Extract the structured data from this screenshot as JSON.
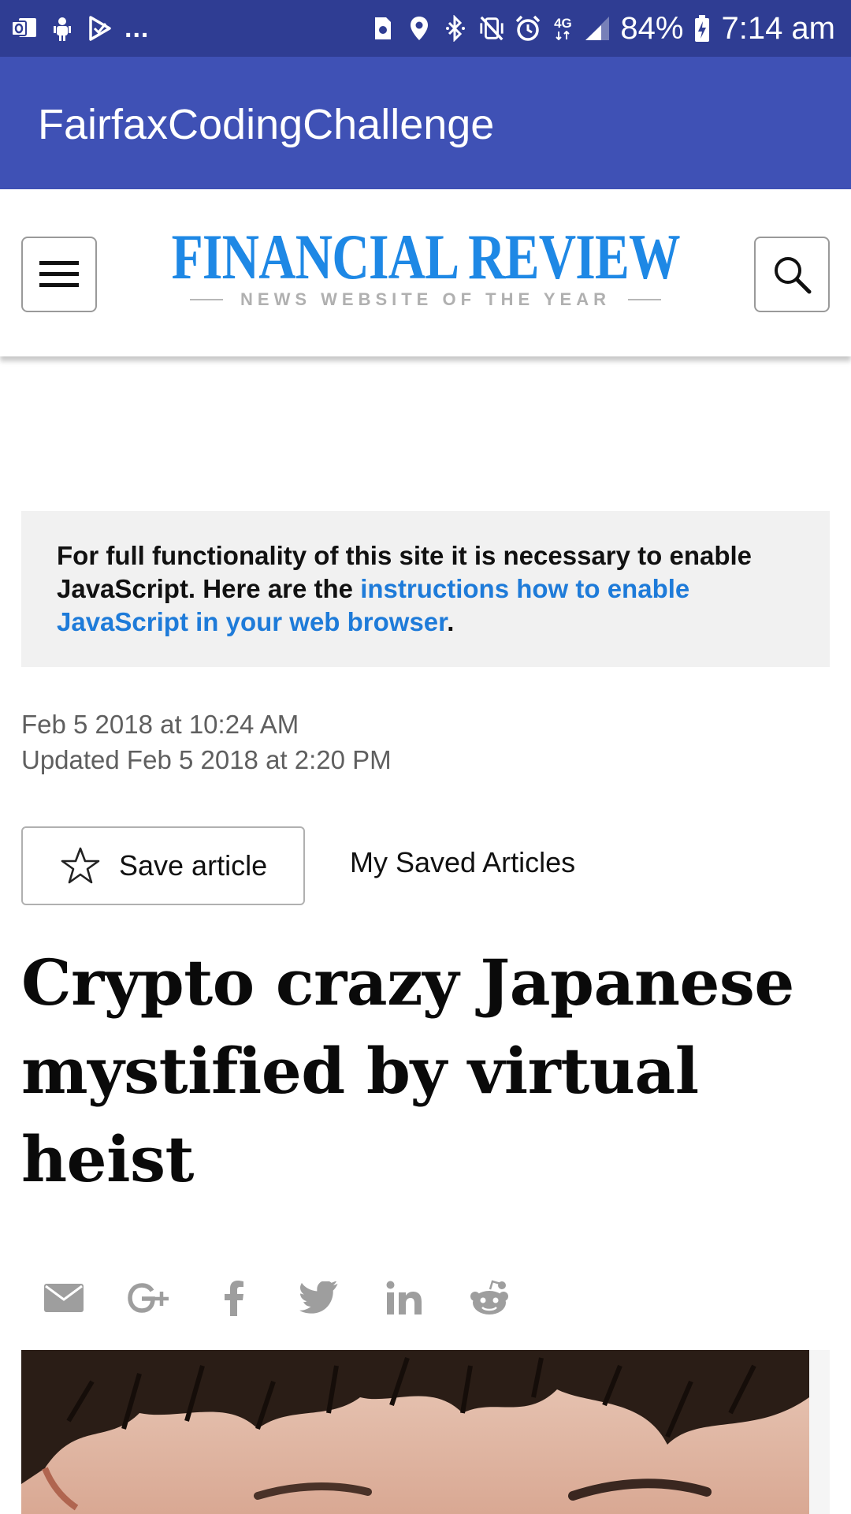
{
  "status_bar": {
    "left_icons": [
      "outlook-icon",
      "usb-debug-icon",
      "play-store-icon"
    ],
    "overflow": "...",
    "right_icons": [
      "sim-card-icon",
      "location-icon",
      "bluetooth-icon",
      "vibrate-mute-icon",
      "alarm-icon",
      "4g-icon",
      "signal-icon"
    ],
    "network": "4G",
    "battery": "84%",
    "time": "7:14 am"
  },
  "app_bar": {
    "title": "FairfaxCodingChallenge"
  },
  "site_header": {
    "logo_title": "FINANCIAL REVIEW",
    "logo_subtitle": "NEWS WEBSITE OF THE YEAR",
    "menu_icon": "hamburger-menu-icon",
    "search_icon": "search-icon"
  },
  "notice": {
    "text_before": "For full functionality of this site it is necessary to enable JavaScript. Here are the ",
    "link_text": "instructions how to enable JavaScript in your web browser",
    "text_after": "."
  },
  "article": {
    "published": "Feb 5 2018 at 10:24 AM",
    "updated": "Updated Feb 5 2018 at 2:20 PM",
    "save_label": "Save article",
    "saved_articles_label": "My Saved Articles",
    "headline": "Crypto crazy Japanese mystified by virtual heist"
  },
  "share": {
    "icons": [
      "email-icon",
      "google-plus-icon",
      "facebook-icon",
      "twitter-icon",
      "linkedin-icon",
      "reddit-icon"
    ]
  },
  "colors": {
    "status_bar": "#2f3d93",
    "app_bar": "#3f51b5",
    "logo_blue": "#1e88e5",
    "link_blue": "#1e7bd9",
    "notice_bg": "#f1f1f1",
    "icon_gray": "#9e9e9e"
  }
}
